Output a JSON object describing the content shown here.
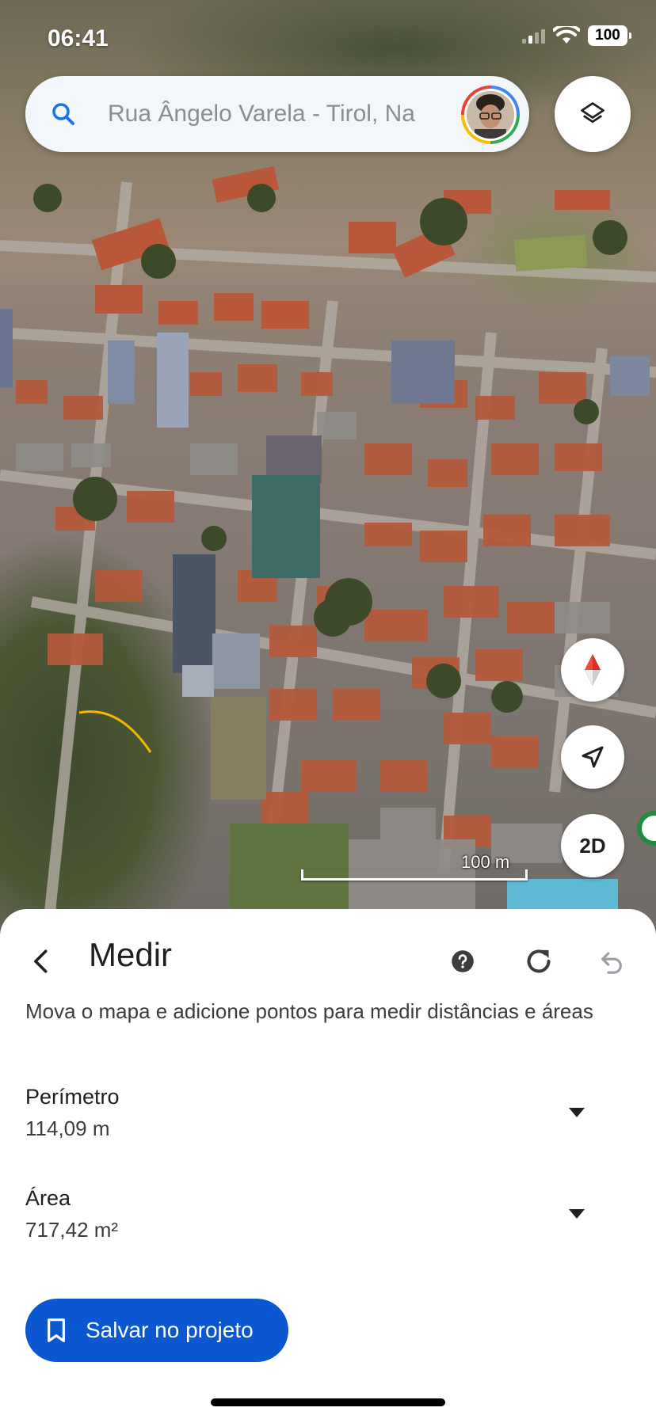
{
  "status_bar": {
    "time": "06:41",
    "battery": "100"
  },
  "search": {
    "placeholder": "Rua Ângelo Varela - Tirol, Na"
  },
  "map": {
    "scale_label": "100 m",
    "view_toggle_label": "2D"
  },
  "measure": {
    "title": "Medir",
    "instructions": "Mova o mapa e adicione pontos para medir distâncias e áreas",
    "perimeter": {
      "label": "Perímetro",
      "value": "114,09 m"
    },
    "area": {
      "label": "Área",
      "value": "717,42 m²"
    },
    "save_label": "Salvar no projeto"
  },
  "colors": {
    "accent": "#0b57d0",
    "compass_red": "#d93025"
  }
}
